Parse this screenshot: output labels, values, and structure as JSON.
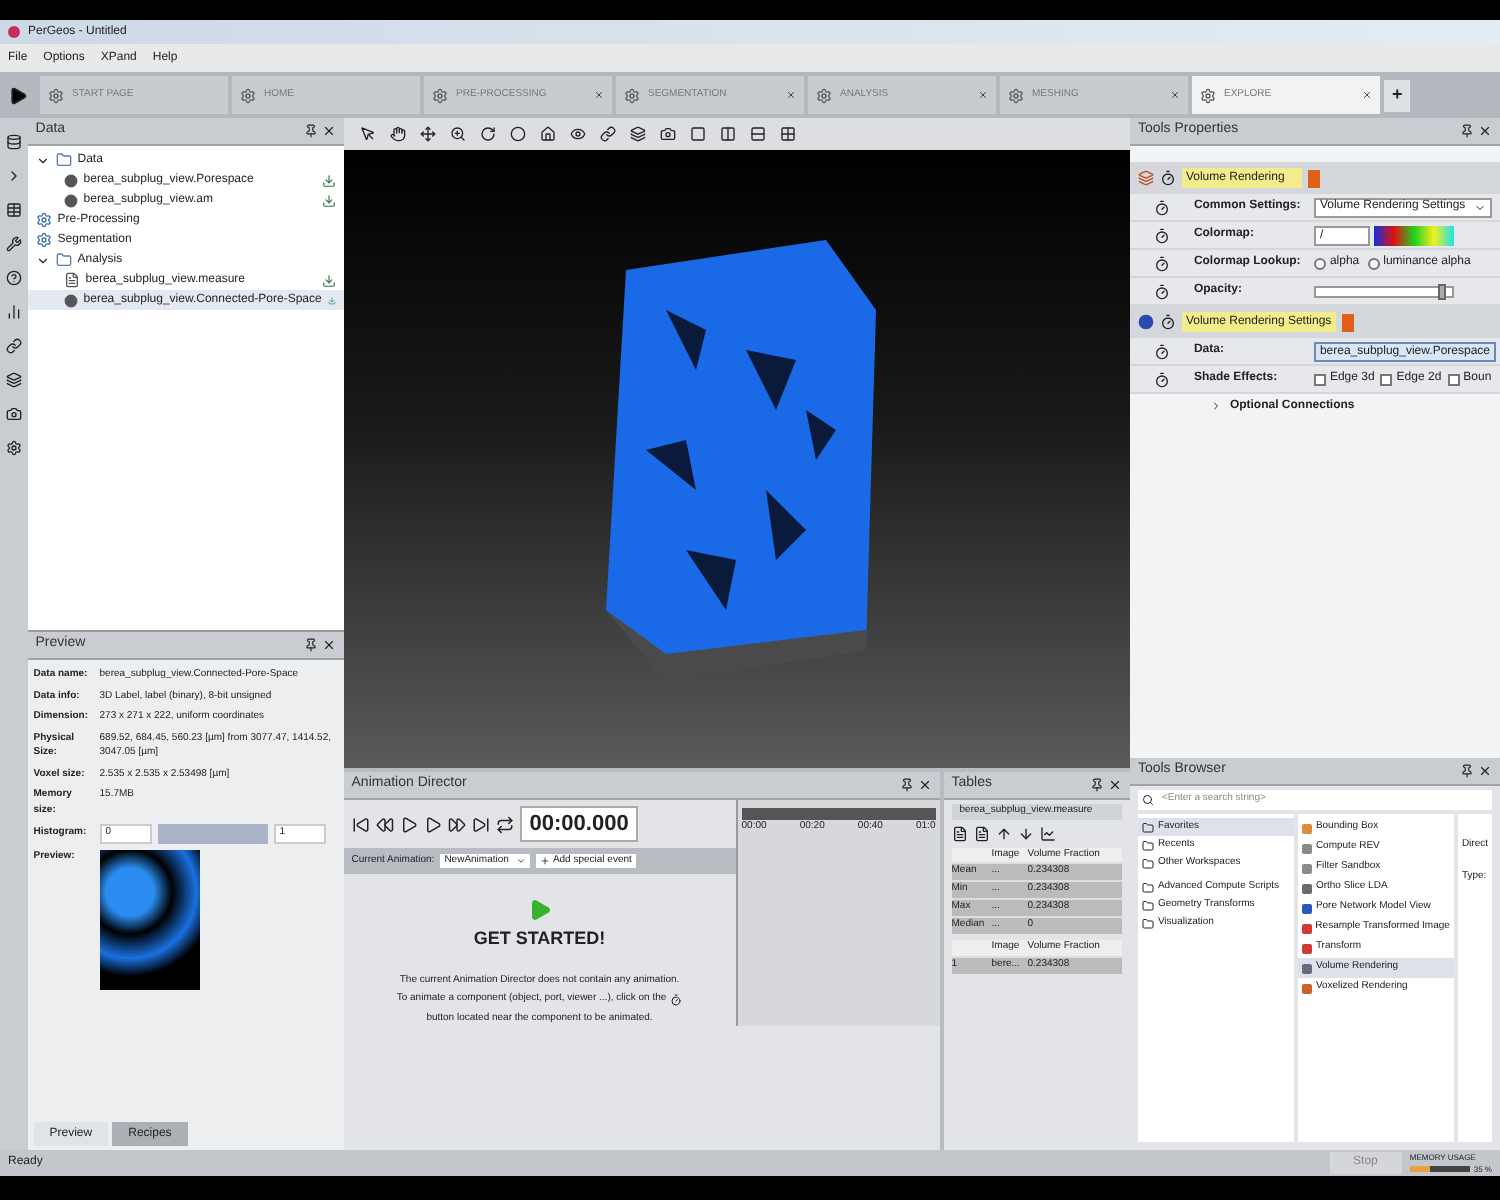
{
  "window": {
    "title": "PerGeos - Untitled"
  },
  "menu": [
    "File",
    "Options",
    "XPand",
    "Help"
  ],
  "workrooms": [
    {
      "label": "START PAGE",
      "selected": false,
      "closable": false
    },
    {
      "label": "HOME",
      "selected": false,
      "closable": false
    },
    {
      "label": "PRE-PROCESSING",
      "selected": false,
      "closable": true
    },
    {
      "label": "SEGMENTATION",
      "selected": false,
      "closable": true
    },
    {
      "label": "ANALYSIS",
      "selected": false,
      "closable": true
    },
    {
      "label": "MESHING",
      "selected": false,
      "closable": true
    },
    {
      "label": "EXPLORE",
      "selected": true,
      "closable": true
    }
  ],
  "add_tab": "+",
  "data_panel": {
    "title": "Data",
    "tree": [
      {
        "label": "Data",
        "kind": "folder",
        "expanded": true,
        "selected": false,
        "children": [
          {
            "label": "berea_subplug_view.Porespace",
            "kind": "object",
            "selected": false
          },
          {
            "label": "berea_subplug_view.am",
            "kind": "object",
            "selected": false
          }
        ]
      },
      {
        "label": "Pre-Processing",
        "kind": "step",
        "selected": false
      },
      {
        "label": "Segmentation",
        "kind": "step",
        "selected": false
      },
      {
        "label": "Analysis",
        "kind": "folder",
        "expanded": true,
        "selected": false,
        "children": [
          {
            "label": "berea_subplug_view.measure",
            "kind": "doc",
            "selected": false
          },
          {
            "label": "berea_subplug_view.Connected-Pore-Space",
            "kind": "object",
            "selected": true
          }
        ]
      }
    ]
  },
  "preview_panel": {
    "title": "Preview",
    "info": [
      {
        "label": "Data name:",
        "value": "berea_subplug_view.Connected-Pore-Space"
      },
      {
        "label": "Data info:",
        "value": "3D Label, label (binary), 8-bit unsigned"
      },
      {
        "label": "Dimension:",
        "value": "273 x 271 x 222, uniform coordinates"
      },
      {
        "label": "Physical Size:",
        "value": "689.52, 684.45, 560.23 [µm] from 3077.47, 1414.52, 3047.05 [µm]"
      },
      {
        "label": "Voxel size:",
        "value": "2.535 x 2.535 x 2.53498 [µm]"
      },
      {
        "label": "Memory size:",
        "value": "15.7MB"
      }
    ],
    "histogram": {
      "label": "Histogram:",
      "min": "0",
      "max": "1"
    },
    "preview_label": "Preview:",
    "tabs": [
      {
        "label": "Preview",
        "selected": true
      },
      {
        "label": "Recipes",
        "selected": false
      }
    ]
  },
  "animation_director": {
    "title": "Animation Director",
    "time": "00:00.000",
    "current_label": "Current Animation:",
    "current_value": "NewAnimation",
    "add_event": "Add special event",
    "ticks": [
      "00:00",
      "00:20",
      "00:40",
      "01:0"
    ],
    "heading": "GET STARTED!",
    "line_1": "The current Animation Director does not contain any animation.",
    "line_2_start": "To animate a component (object, port, viewer ...), click on the",
    "line_2_end": "button located near the component to be animated."
  },
  "tables": {
    "title": "Tables",
    "tab": "berea_subplug_view.measure",
    "table_1": {
      "columns": [
        "",
        "Image",
        "Volume Fraction"
      ],
      "rows": [
        [
          "Mean",
          "...",
          "0.234308"
        ],
        [
          "Min",
          "...",
          "0.234308"
        ],
        [
          "Max",
          "...",
          "0.234308"
        ],
        [
          "Median",
          "...",
          "0"
        ]
      ]
    },
    "table_2": {
      "columns": [
        "",
        "Image",
        "Volume Fraction"
      ],
      "rows": [
        [
          "1",
          "bere...",
          "0.234308"
        ]
      ]
    }
  },
  "tools_properties": {
    "title": "Tools Properties",
    "modules": [
      {
        "name": "Volume Rendering",
        "kind": "module",
        "rows": [
          {
            "label": "Common Settings:",
            "kind": "dropdown",
            "value": "Volume Rendering Settings"
          },
          {
            "label": "Colormap:",
            "kind": "colormap",
            "value": "/"
          },
          {
            "label": "Colormap Lookup:",
            "kind": "radio",
            "options": [
              {
                "label": "alpha",
                "selected": false
              },
              {
                "label": "luminance alpha",
                "selected": false
              }
            ]
          },
          {
            "label": "Opacity:",
            "kind": "slider",
            "level": 0.96
          }
        ]
      },
      {
        "name": "Volume Rendering Settings",
        "kind": "settings",
        "rows": [
          {
            "label": "Data:",
            "kind": "field",
            "value": "berea_subplug_view.Porespace"
          },
          {
            "label": "Shade Effects:",
            "kind": "checks",
            "options": [
              {
                "label": "Edge 3d",
                "checked": false
              },
              {
                "label": "Edge 2d",
                "checked": false
              },
              {
                "label": "Boun",
                "checked": false
              }
            ]
          }
        ]
      }
    ],
    "optional": "Optional Connections"
  },
  "tools_browser": {
    "title": "Tools Browser",
    "search_placeholder": "<Enter a search string>",
    "categories": [
      {
        "label": "Favorites",
        "selected": true
      },
      {
        "label": "Recents",
        "selected": false
      },
      {
        "label": "Other Workspaces",
        "selected": false
      },
      {
        "label": "Advanced Compute Scripts",
        "selected": false
      },
      {
        "label": "Geometry Transforms",
        "selected": false
      },
      {
        "label": "Visualization",
        "selected": false
      }
    ],
    "tools": [
      {
        "label": "Bounding Box",
        "color": "#e08a3c",
        "selected": false
      },
      {
        "label": "Compute REV",
        "color": "#8a8a8a",
        "selected": false
      },
      {
        "label": "Filter Sandbox",
        "color": "#8a8a8a",
        "selected": false
      },
      {
        "label": "Ortho Slice LDA",
        "color": "#6a6a6a",
        "selected": false
      },
      {
        "label": "Pore Network Model View",
        "color": "#2a5ab8",
        "selected": false
      },
      {
        "label": "Resample Transformed Image",
        "color": "#d03a3a",
        "selected": false
      },
      {
        "label": "Transform",
        "color": "#d03a3a",
        "selected": false
      },
      {
        "label": "Volume Rendering",
        "color": "#6a6a7a",
        "selected": true
      },
      {
        "label": "Voxelized Rendering",
        "color": "#d0602a",
        "selected": false
      }
    ],
    "side_labels": [
      "Direct",
      "Type:"
    ]
  },
  "status_bar": {
    "text": "Ready",
    "stop": "Stop",
    "memory_label": "MEMORY USAGE",
    "memory": {
      "level": 0.35
    },
    "memory_text": "35 %"
  }
}
